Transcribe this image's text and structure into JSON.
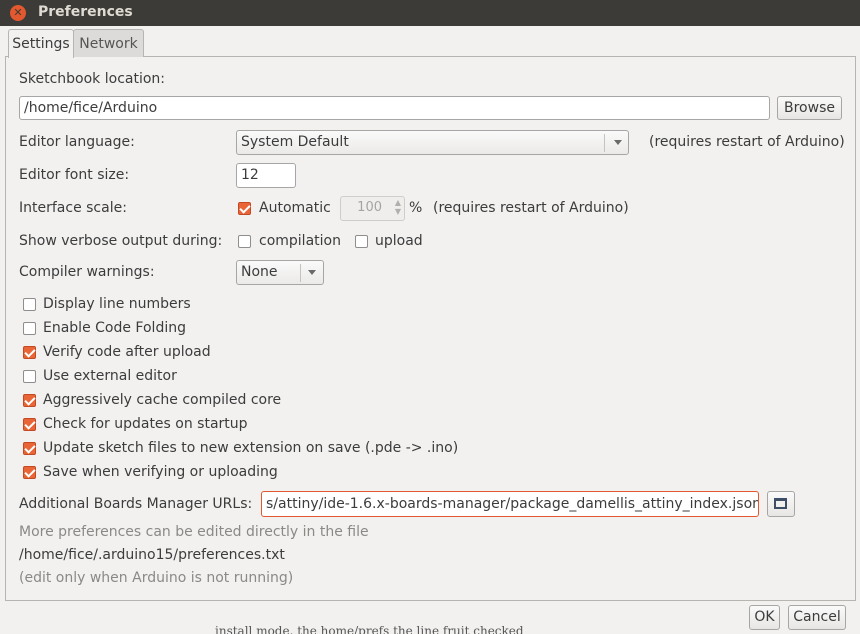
{
  "window": {
    "title": "Preferences",
    "close_icon": "close-icon"
  },
  "tabs": [
    {
      "label": "Settings",
      "active": true
    },
    {
      "label": "Network",
      "active": false
    }
  ],
  "sketchbook": {
    "label": "Sketchbook location:",
    "value": "/home/fice/Arduino",
    "browse_label": "Browse"
  },
  "language": {
    "label": "Editor language:",
    "value": "System Default",
    "note": "(requires restart of Arduino)"
  },
  "font_size": {
    "label": "Editor font size:",
    "value": "12"
  },
  "scale": {
    "label": "Interface scale:",
    "automatic_label": "Automatic",
    "automatic_checked": true,
    "value": "100",
    "unit": "%",
    "note": "(requires restart of Arduino)"
  },
  "verbose": {
    "label": "Show verbose output during:",
    "compilation_label": "compilation",
    "compilation_checked": false,
    "upload_label": "upload",
    "upload_checked": false
  },
  "warnings": {
    "label": "Compiler warnings:",
    "value": "None"
  },
  "options": [
    {
      "label": "Display line numbers",
      "checked": false
    },
    {
      "label": "Enable Code Folding",
      "checked": false
    },
    {
      "label": "Verify code after upload",
      "checked": true
    },
    {
      "label": "Use external editor",
      "checked": false
    },
    {
      "label": "Aggressively cache compiled core",
      "checked": true
    },
    {
      "label": "Check for updates on startup",
      "checked": true
    },
    {
      "label": "Update sketch files to new extension on save (.pde -> .ino)",
      "checked": true
    },
    {
      "label": "Save when verifying or uploading",
      "checked": true
    }
  ],
  "boards": {
    "label": "Additional Boards Manager URLs:",
    "value": "s/attiny/ide-1.6.x-boards-manager/package_damellis_attiny_index.json",
    "button_icon": "window-icon"
  },
  "more": {
    "line1": "More preferences can be edited directly in the file",
    "path": "/home/fice/.arduino15/preferences.txt",
    "line3": "(edit only when Arduino is not running)"
  },
  "footer": {
    "ok_label": "OK",
    "cancel_label": "Cancel"
  },
  "background_text": "install mode. the home/prefs the line fruit checked"
}
